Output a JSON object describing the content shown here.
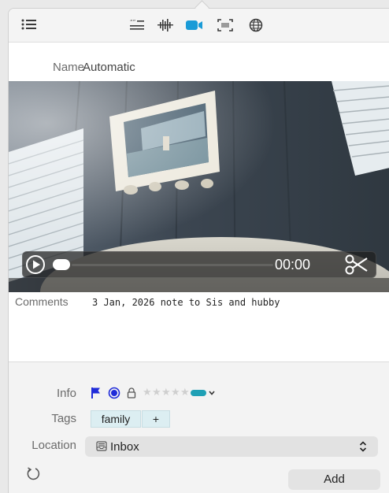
{
  "toolbar": {
    "icons": [
      "list-icon",
      "markdown-icon",
      "audio-waveform-icon",
      "video-icon",
      "screenshot-icon",
      "web-icon"
    ],
    "accent": "#1a9bd7"
  },
  "name": {
    "label": "Name",
    "value": "Automatic"
  },
  "video": {
    "time": "00:00",
    "icons": [
      "play-icon",
      "scissors-icon"
    ]
  },
  "comments": {
    "label": "Comments",
    "text": "3 Jan, 2026 note to Sis and hubby"
  },
  "info": {
    "label": "Info",
    "flag_color": "#1f2bd9",
    "label_color": "#1f2bd9",
    "rating": 0,
    "rating_max": 5,
    "color_chip": "#1fa0b5",
    "icons": [
      "flag-icon",
      "label-dot-icon",
      "lock-icon",
      "star-icon",
      "color-swatch-icon",
      "chevron-down-icon"
    ]
  },
  "tags": {
    "label": "Tags",
    "items": [
      "family"
    ],
    "add_label": "+"
  },
  "location": {
    "label": "Location",
    "value": "Inbox",
    "icon": "inbox-icon"
  },
  "footer": {
    "add_label": "Add",
    "refresh_icon": "refresh-icon"
  }
}
